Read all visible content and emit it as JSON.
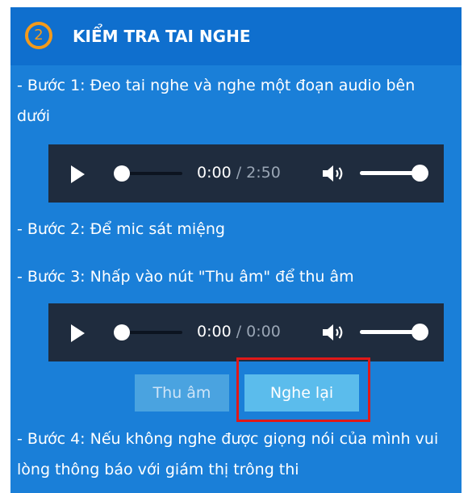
{
  "header": {
    "step_number": "2",
    "title": "KIỂM TRA TAI NGHE"
  },
  "steps": {
    "step1": "- Bước 1: Đeo tai nghe và nghe một đoạn audio bên dưới",
    "step2": "- Bước 2: Để mic sát miệng",
    "step3": "- Bước 3: Nhấp vào nút \"Thu âm\" để thu âm",
    "step4": "- Bước 4: Nếu không nghe được giọng nói của mình vui lòng thông báo với giám thị trông thi"
  },
  "audio_player_1": {
    "current_time": "0:00",
    "separator": " / ",
    "total_time": "2:50",
    "progress_fraction": 0,
    "volume_fraction": 1
  },
  "audio_player_2": {
    "current_time": "0:00",
    "separator": " / ",
    "total_time": "0:00",
    "progress_fraction": 0,
    "volume_fraction": 1
  },
  "buttons": {
    "record_label": "Thu âm",
    "replay_label": "Nghe lại"
  },
  "colors": {
    "panel_background": "#1a7fd8",
    "header_background": "#0f6fce",
    "step_circle": "#f39a1b",
    "player_background": "#1f2c3e",
    "record_button": "#4aa3e0",
    "replay_button": "#5bbcec",
    "highlight_border": "#e01818"
  },
  "icons": {
    "play": "play-icon",
    "volume": "volume-icon"
  }
}
